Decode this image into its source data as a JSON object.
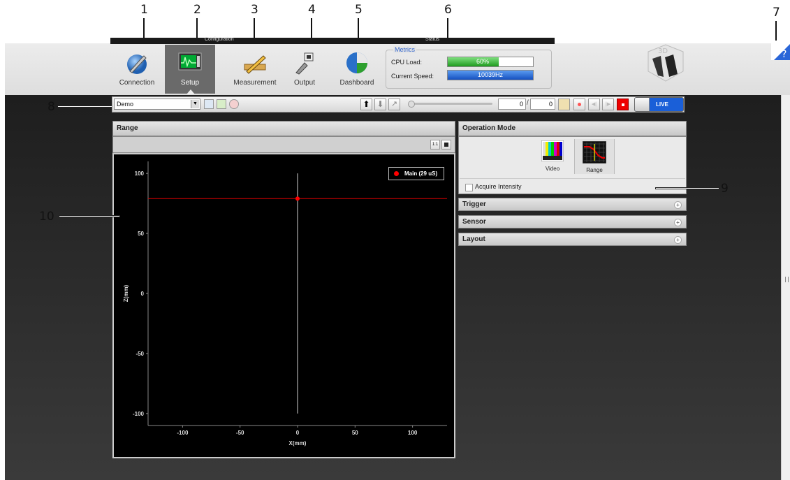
{
  "callouts": [
    "1",
    "2",
    "3",
    "4",
    "5",
    "6",
    "7",
    "8",
    "9",
    "10"
  ],
  "toolbar": {
    "configuration_label": "Configuration",
    "status_label": "Status",
    "tools": [
      {
        "label": "Connection",
        "icon": "wrench-globe-icon"
      },
      {
        "label": "Setup",
        "icon": "monitor-waveform-icon"
      },
      {
        "label": "Measurement",
        "icon": "ruler-pencil-icon"
      },
      {
        "label": "Output",
        "icon": "network-plug-icon"
      },
      {
        "label": "Dashboard",
        "icon": "pie-globe-icon"
      }
    ],
    "metrics": {
      "legend": "Metrics",
      "cpu_label": "CPU Load:",
      "cpu_value": "60%",
      "cpu_fraction": 0.6,
      "speed_label": "Current Speed:",
      "speed_value": "10039Hz",
      "speed_fraction": 1.0
    },
    "logo": "3D-logo"
  },
  "controls": {
    "job_select": "Demo",
    "frame_current": "0",
    "frame_total": "0",
    "live_label": "LIVE"
  },
  "range_panel": {
    "title": "Range",
    "legend": "Main (29 uS)",
    "xlabel": "X(mm)",
    "ylabel": "Z(mm)"
  },
  "operation_mode": {
    "title": "Operation Mode",
    "video_label": "Video",
    "range_label": "Range",
    "acquire_label": "Acquire Intensity",
    "sections": [
      "Trigger",
      "Sensor",
      "Layout"
    ]
  },
  "chart_data": {
    "type": "scatter",
    "xlabel": "X(mm)",
    "ylabel": "Z(mm)",
    "xlim": [
      -130,
      130
    ],
    "ylim": [
      -110,
      110
    ],
    "xticks": [
      -100,
      -50,
      0,
      50,
      100
    ],
    "yticks": [
      100,
      50,
      0,
      -50,
      -100
    ],
    "series": [
      {
        "name": "Main (29 uS)",
        "color": "#ff0000",
        "points": [
          [
            0,
            79
          ]
        ]
      }
    ],
    "crosshair": {
      "x": 0,
      "y": 79
    },
    "legend_position": "top-right"
  }
}
